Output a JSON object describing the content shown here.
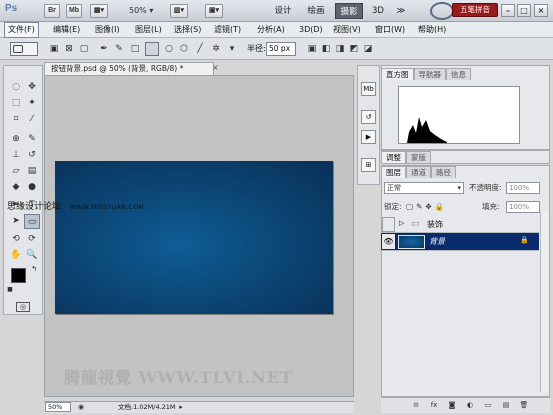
{
  "titlebar": {
    "logo": "Ps",
    "br": "Br",
    "mb": "Mb",
    "zoom": "50%",
    "workspaces": [
      "设计",
      "绘画",
      "摄影",
      "3D",
      "≫"
    ],
    "active_workspace": "摄影",
    "ime_badge": "五笔拼音",
    "controls": [
      "–",
      "□",
      "×"
    ]
  },
  "menu": [
    "文件(F)",
    "编辑(E)",
    "图像(I)",
    "图层(L)",
    "选择(S)",
    "滤镜(T)",
    "分析(A)",
    "3D(D)",
    "视图(V)",
    "窗口(W)",
    "帮助(H)"
  ],
  "options": {
    "radius_label": "半径:",
    "radius_value": "50 px"
  },
  "document": {
    "tab_title": "按钮背景.psd @ 50% (背景, RGB/8) *",
    "close": "×",
    "zoom": "50%",
    "info": "文档:1.02M/4.21M"
  },
  "overlay": {
    "site_cn": "思缘设计论坛",
    "site_url": "WWW.MISSYUAN.COM",
    "watermark": "腾龍視覺 WWW.TLVI.NET"
  },
  "panels": {
    "top_tabs": [
      "直方图",
      "导航器",
      "信息"
    ],
    "mid_tabs": [
      "调整",
      "蒙版"
    ],
    "layer_tabs": [
      "图层",
      "通道",
      "路径"
    ],
    "blend_mode": "正常",
    "opacity_label": "不透明度:",
    "opacity_value": "100%",
    "lock_label": "锁定:",
    "fill_label": "填充:",
    "fill_value": "100%",
    "layers": [
      {
        "name": "装饰",
        "type": "group",
        "selected": false
      },
      {
        "name": "背景",
        "type": "layer",
        "selected": true
      }
    ]
  },
  "colors": {
    "canvas": "#0c4a7a",
    "selected_layer": "#0a2a6e",
    "active_workspace": "#5d6470"
  }
}
